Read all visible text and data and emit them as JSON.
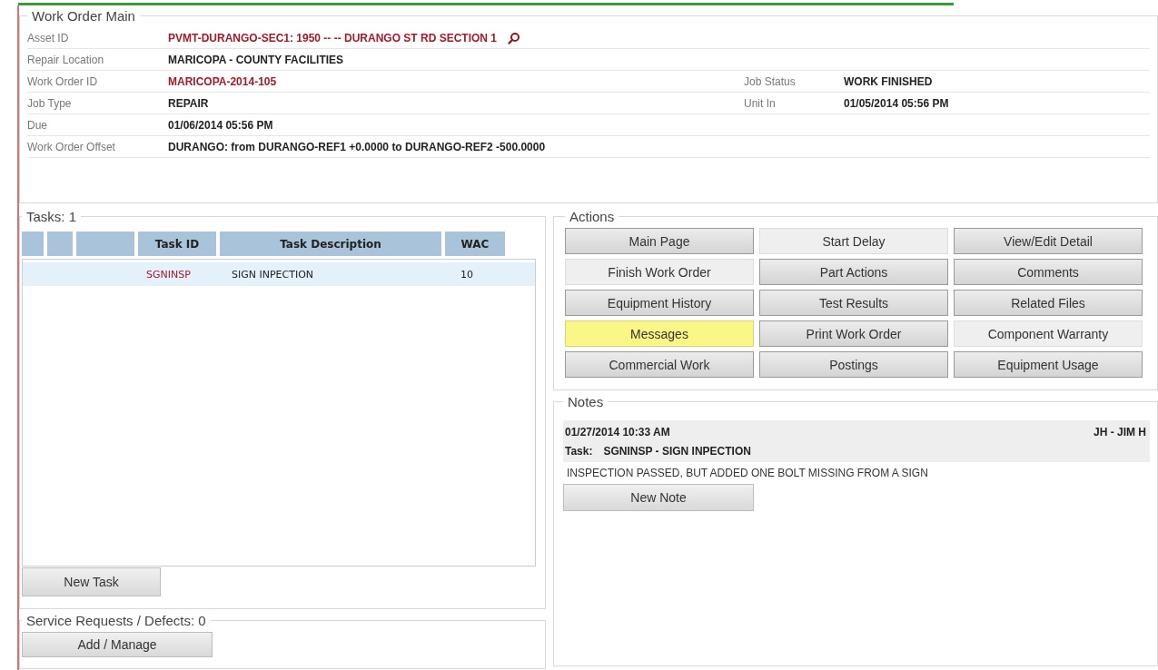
{
  "work_order_main": {
    "title": "Work Order Main",
    "rows": [
      {
        "label": "Asset ID",
        "value": "PVMT-DURANGO-SEC1:  1950 -- -- DURANGO ST RD SECTION 1",
        "kind": "asset"
      },
      {
        "label": "Repair Location",
        "value": "MARICOPA - COUNTY FACILITIES",
        "kind": "plain"
      },
      {
        "label": "Work Order ID",
        "value": "MARICOPA-2014-105",
        "kind": "link",
        "right_label": "Job Status",
        "right_value": "WORK FINISHED"
      },
      {
        "label": "Job Type",
        "value": "REPAIR",
        "kind": "plain",
        "right_label": "Unit In",
        "right_value": "01/05/2014 05:56 PM"
      },
      {
        "label": "Due",
        "value": "01/06/2014 05:56 PM",
        "kind": "plain"
      },
      {
        "label": "Work Order Offset",
        "value": "DURANGO: from DURANGO-REF1 +0.0000 to DURANGO-REF2 -500.0000",
        "kind": "plain"
      }
    ]
  },
  "tasks": {
    "title": "Tasks: 1",
    "columns": [
      "Task ID",
      "Task Description",
      "WAC"
    ],
    "rows": [
      {
        "task_id": "SGNINSP",
        "description": "SIGN INPECTION",
        "wac": "10",
        "selected": true
      }
    ],
    "button": "New Task"
  },
  "service_requests": {
    "title": "Service Requests / Defects: 0",
    "button": "Add / Manage"
  },
  "actions": {
    "title": "Actions",
    "buttons": [
      {
        "label": "Main Page",
        "kind": "raised"
      },
      {
        "label": "Start Delay",
        "kind": "flat"
      },
      {
        "label": "View/Edit Detail",
        "kind": "raised"
      },
      {
        "label": "Finish Work Order",
        "kind": "flat"
      },
      {
        "label": "Part Actions",
        "kind": "raised"
      },
      {
        "label": "Comments",
        "kind": "raised"
      },
      {
        "label": "Equipment History",
        "kind": "raised"
      },
      {
        "label": "Test Results",
        "kind": "raised"
      },
      {
        "label": "Related Files",
        "kind": "raised"
      },
      {
        "label": "Messages",
        "kind": "highlight"
      },
      {
        "label": "Print Work Order",
        "kind": "raised"
      },
      {
        "label": "Component Warranty",
        "kind": "flat"
      },
      {
        "label": "Commercial Work",
        "kind": "raised"
      },
      {
        "label": "Postings",
        "kind": "raised"
      },
      {
        "label": "Equipment Usage",
        "kind": "raised"
      }
    ]
  },
  "notes": {
    "title": "Notes",
    "items": [
      {
        "date": "01/27/2014 10:33 AM",
        "author": "JH - JIM H",
        "task_label": "Task:",
        "task": "SGNINSP - SIGN INPECTION",
        "text": "INSPECTION PASSED, BUT ADDED ONE BOLT MISSING FROM A SIGN"
      }
    ],
    "button": "New Note"
  }
}
